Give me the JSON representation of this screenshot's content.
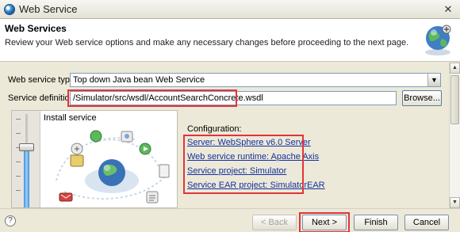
{
  "window": {
    "title": "Web Service",
    "close_glyph": "✕"
  },
  "header": {
    "title": "Web Services",
    "description": "Review your Web service options and make any necessary changes before proceeding to the next page."
  },
  "form": {
    "service_type_label": "Web service type:",
    "service_type_value": "Top down Java bean Web Service",
    "service_def_label": "Service definition:",
    "service_def_value": "/Simulator/src/wsdl/AccountSearchConcrete.wsdl",
    "browse_label": "Browse..."
  },
  "install": {
    "label": "Install service"
  },
  "configuration": {
    "title": "Configuration:",
    "links": [
      "Server: WebSphere v6.0 Server",
      "Web service runtime: Apache Axis",
      "Service project: Simulator",
      "Service EAR project: SimulatorEAR"
    ]
  },
  "footer": {
    "help_glyph": "?",
    "back_label": "< Back",
    "next_label": "Next >",
    "finish_label": "Finish",
    "cancel_label": "Cancel"
  },
  "icons": {
    "title": "eclipse-icon",
    "header": "globe-wizard-icon",
    "dropdown": "chevron-down-icon",
    "help": "help-icon"
  },
  "colors": {
    "highlight": "#e2343a",
    "link": "#1530a0"
  }
}
